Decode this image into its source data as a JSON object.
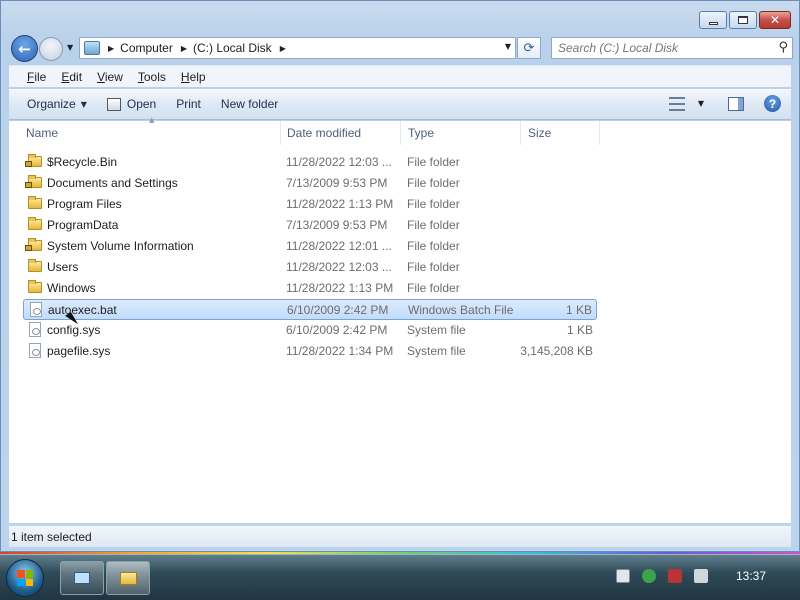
{
  "window": {
    "nav_back_label": "←",
    "address": {
      "crumbs": [
        "Computer",
        "(C:) Local Disk"
      ],
      "dropdown": "▼"
    },
    "refresh": "⟳",
    "search": {
      "placeholder": "Search (C:) Local Disk",
      "icon": "search-icon"
    }
  },
  "menu": [
    "File",
    "Edit",
    "View",
    "Tools",
    "Help"
  ],
  "toolbar": {
    "organize": "Organize",
    "open": "Open",
    "print": "Print",
    "new_folder": "New folder"
  },
  "columns": [
    "Name",
    "Date modified",
    "Type",
    "Size"
  ],
  "files": [
    {
      "name": "$Recycle.Bin",
      "date": "11/28/2022 12:03 ...",
      "type": "File folder",
      "size": "",
      "icon": "folder-locked"
    },
    {
      "name": "Documents and Settings",
      "date": "7/13/2009 9:53 PM",
      "type": "File folder",
      "size": "",
      "icon": "folder-locked"
    },
    {
      "name": "Program Files",
      "date": "11/28/2022 1:13 PM",
      "type": "File folder",
      "size": "",
      "icon": "folder"
    },
    {
      "name": "ProgramData",
      "date": "7/13/2009 9:53 PM",
      "type": "File folder",
      "size": "",
      "icon": "folder"
    },
    {
      "name": "System Volume Information",
      "date": "11/28/2022 12:01 ...",
      "type": "File folder",
      "size": "",
      "icon": "folder-locked"
    },
    {
      "name": "Users",
      "date": "11/28/2022 12:03 ...",
      "type": "File folder",
      "size": "",
      "icon": "folder"
    },
    {
      "name": "Windows",
      "date": "11/28/2022 1:13 PM",
      "type": "File folder",
      "size": "",
      "icon": "folder"
    },
    {
      "name": "autoexec.bat",
      "date": "6/10/2009 2:42 PM",
      "type": "Windows Batch File",
      "size": "1 KB",
      "icon": "file"
    },
    {
      "name": "config.sys",
      "date": "6/10/2009 2:42 PM",
      "type": "System file",
      "size": "1 KB",
      "icon": "file"
    },
    {
      "name": "pagefile.sys",
      "date": "11/28/2022 1:34 PM",
      "type": "System file",
      "size": "3,145,208 KB",
      "icon": "file"
    }
  ],
  "selected_index": 7,
  "status": "1 item selected",
  "taskbar": {
    "clock": "13:37"
  },
  "colors": {
    "selection": "#c1dcfc",
    "accent": "#2a64b5"
  }
}
